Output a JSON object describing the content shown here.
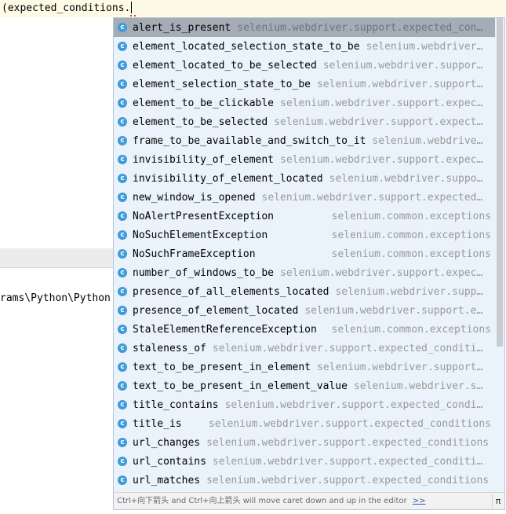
{
  "editor": {
    "line_text": "(expected_conditions.",
    "path_text": "rams\\Python\\Python"
  },
  "completion": {
    "items": [
      {
        "name": "alert_is_present",
        "module": "selenium.webdriver.support.expected_con…",
        "icon": "class-icon"
      },
      {
        "name": "element_located_selection_state_to_be",
        "module": "selenium.webdriver…",
        "icon": "class-icon"
      },
      {
        "name": "element_located_to_be_selected",
        "module": "selenium.webdriver.suppor…",
        "icon": "class-icon"
      },
      {
        "name": "element_selection_state_to_be",
        "module": "selenium.webdriver.support…",
        "icon": "class-icon"
      },
      {
        "name": "element_to_be_clickable",
        "module": "selenium.webdriver.support.expec…",
        "icon": "class-icon"
      },
      {
        "name": "element_to_be_selected",
        "module": "selenium.webdriver.support.expect…",
        "icon": "class-icon"
      },
      {
        "name": "frame_to_be_available_and_switch_to_it",
        "module": "selenium.webdrive…",
        "icon": "class-icon"
      },
      {
        "name": "invisibility_of_element",
        "module": "selenium.webdriver.support.expec…",
        "icon": "class-icon"
      },
      {
        "name": "invisibility_of_element_located",
        "module": "selenium.webdriver.suppo…",
        "icon": "class-icon"
      },
      {
        "name": "new_window_is_opened",
        "module": "selenium.webdriver.support.expected…",
        "icon": "class-icon"
      },
      {
        "name": "NoAlertPresentException",
        "module": "selenium.common.exceptions",
        "icon": "class-icon",
        "aligned": true
      },
      {
        "name": "NoSuchElementException",
        "module": "selenium.common.exceptions",
        "icon": "class-icon",
        "aligned": true
      },
      {
        "name": "NoSuchFrameException",
        "module": "selenium.common.exceptions",
        "icon": "class-icon",
        "aligned": true
      },
      {
        "name": "number_of_windows_to_be",
        "module": "selenium.webdriver.support.expec…",
        "icon": "class-icon"
      },
      {
        "name": "presence_of_all_elements_located",
        "module": "selenium.webdriver.supp…",
        "icon": "class-icon"
      },
      {
        "name": "presence_of_element_located",
        "module": "selenium.webdriver.support.e…",
        "icon": "class-icon"
      },
      {
        "name": "StaleElementReferenceException",
        "module": "selenium.common.exceptions",
        "icon": "class-icon",
        "aligned": true
      },
      {
        "name": "staleness_of",
        "module": "selenium.webdriver.support.expected_conditi…",
        "icon": "class-icon"
      },
      {
        "name": "text_to_be_present_in_element",
        "module": "selenium.webdriver.support…",
        "icon": "class-icon"
      },
      {
        "name": "text_to_be_present_in_element_value",
        "module": "selenium.webdriver.s…",
        "icon": "class-icon"
      },
      {
        "name": "title_contains",
        "module": "selenium.webdriver.support.expected_condi…",
        "icon": "class-icon"
      },
      {
        "name": "title_is",
        "module": "selenium.webdriver.support.expected_conditions",
        "icon": "class-icon",
        "aligned": true
      },
      {
        "name": "url_changes",
        "module": "selenium.webdriver.support.expected_conditions",
        "icon": "class-icon"
      },
      {
        "name": "url_contains",
        "module": "selenium.webdriver.support.expected_conditi…",
        "icon": "class-icon"
      },
      {
        "name": "url_matches",
        "module": "selenium.webdriver.support.expected_conditions",
        "icon": "class-icon"
      }
    ],
    "icon_letter": "c",
    "selected_index": 0,
    "footer_hint": "Ctrl+向下箭头 and Ctrl+向上箭头 will move caret down and up in the editor",
    "footer_link": ">>",
    "pin_label": "π"
  },
  "colors": {
    "icon_blue": "#3e9bd8",
    "popup_bg": "#eaf2fb",
    "selected_bg": "#a4adb6",
    "editor_line_bg": "#fdfbe6"
  }
}
